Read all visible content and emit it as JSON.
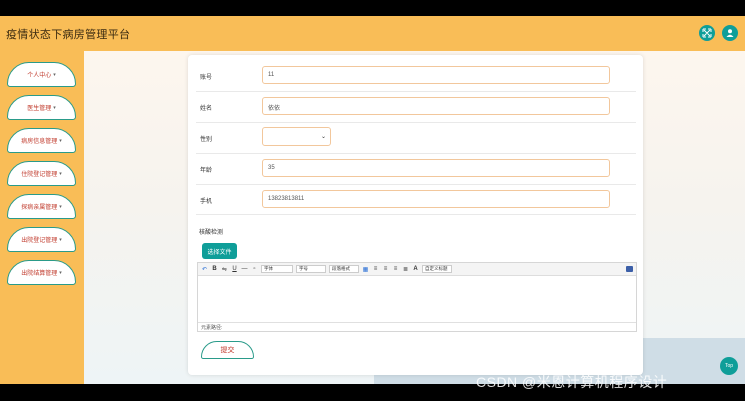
{
  "header": {
    "title": "疫情状态下病房管理平台",
    "accent": "#0f9e99",
    "bg": "#f9bd57",
    "icons": [
      "expand-icon",
      "user-icon"
    ]
  },
  "sidebar": {
    "items": [
      {
        "label": "个人中心"
      },
      {
        "label": "医生管理"
      },
      {
        "label": "病房信息管理"
      },
      {
        "label": "住院登记管理"
      },
      {
        "label": "探病亲属管理"
      },
      {
        "label": "出院登记管理"
      },
      {
        "label": "出院结算管理"
      }
    ]
  },
  "form": {
    "fields": {
      "account": {
        "label": "账号",
        "value": "11"
      },
      "name": {
        "label": "姓名",
        "value": "依依"
      },
      "gender": {
        "label": "性别",
        "value": ""
      },
      "age": {
        "label": "年龄",
        "value": "35"
      },
      "phone": {
        "label": "手机",
        "value": "13823813811"
      }
    },
    "nucleic_test_label": "核酸检测",
    "upload_button": "选择文件",
    "editor": {
      "font_family": "字体",
      "font_size": "字号",
      "paragraph": "段落格式",
      "custom_title": "自定义标题",
      "path_label": "元素路径:"
    },
    "submit_label": "提交"
  },
  "footer": {
    "watermark": "CSDN @米恩计算机程序设计",
    "top_button": "Top"
  }
}
